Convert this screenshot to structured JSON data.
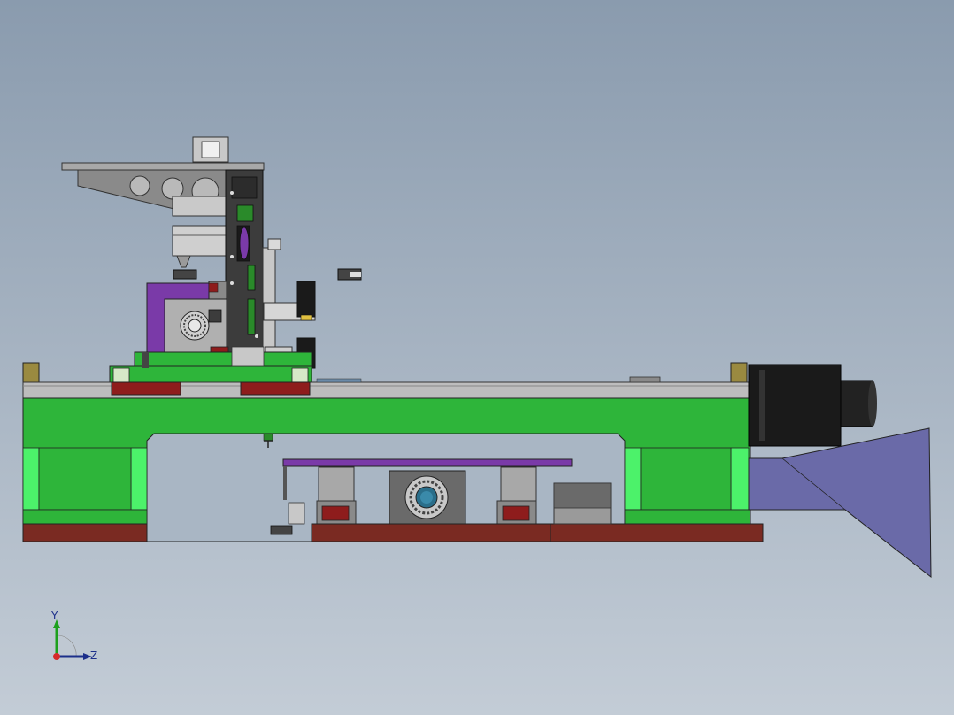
{
  "viewport": {
    "background_top": "#8a9bae",
    "background_bottom": "#c3ccd6"
  },
  "model": {
    "colors": {
      "frame_green": "#2eb53a",
      "frame_light_green": "#4cf26a",
      "rail_grey": "#bdbdbd",
      "bearing_block_red": "#8e1c1c",
      "base_brown": "#7a2a22",
      "carriage_purple": "#7a3aa8",
      "motor_black": "#1a1a1a",
      "hopper_blue": "#6a6aa8",
      "bracket_olive": "#9a8a40",
      "plate_grey": "#8a8a8a",
      "dark_plate": "#3c3c3c"
    },
    "icons": [
      "bearing-icon",
      "servo-motor-icon",
      "coordinate-triad-icon"
    ]
  },
  "triad": {
    "y_label": "Y",
    "z_label": "Z",
    "y_color": "#1da01d",
    "z_color": "#1c2f8a",
    "origin_color": "#d62a2a"
  }
}
